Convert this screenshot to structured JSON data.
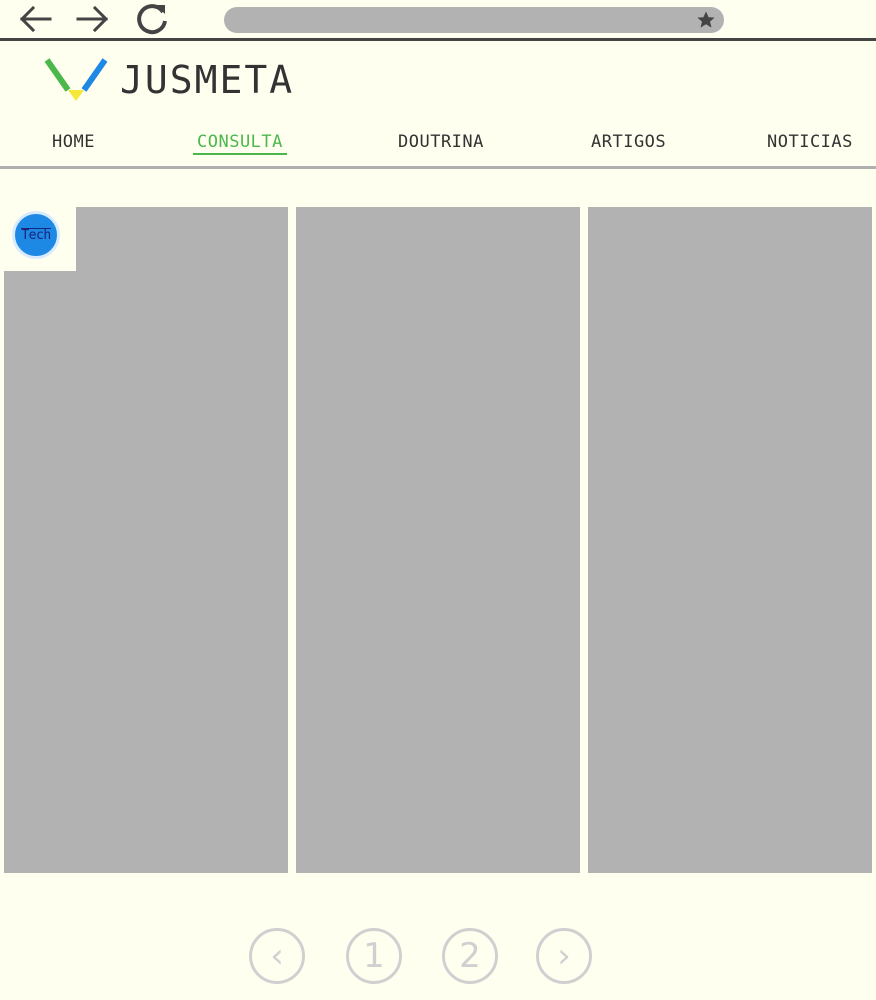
{
  "browser": {
    "back_icon": "arrow-left-icon",
    "forward_icon": "arrow-right-icon",
    "reload_icon": "reload-icon",
    "bookmark_icon": "star-icon",
    "address": ""
  },
  "site": {
    "title": "JUSMETA",
    "logo_colors": {
      "left": "#4cb84c",
      "right": "#1e88e5",
      "bottom": "#f5e83a"
    }
  },
  "nav": {
    "items": [
      {
        "label": "HOME",
        "active": false
      },
      {
        "label": "CONSULTA",
        "active": true
      },
      {
        "label": "DOUTRINA",
        "active": false
      },
      {
        "label": "ARTIGOS",
        "active": false
      },
      {
        "label": "NOTICIAS",
        "active": false
      }
    ],
    "active_color": "#4cb84c"
  },
  "badge": {
    "label": "Tech",
    "color": "#1e88e5"
  },
  "cards": {
    "count": 3,
    "placeholder_color": "#b2b2b2"
  },
  "pagination": {
    "prev_label": "‹",
    "pages": [
      "1",
      "2"
    ],
    "next_label": "›"
  }
}
